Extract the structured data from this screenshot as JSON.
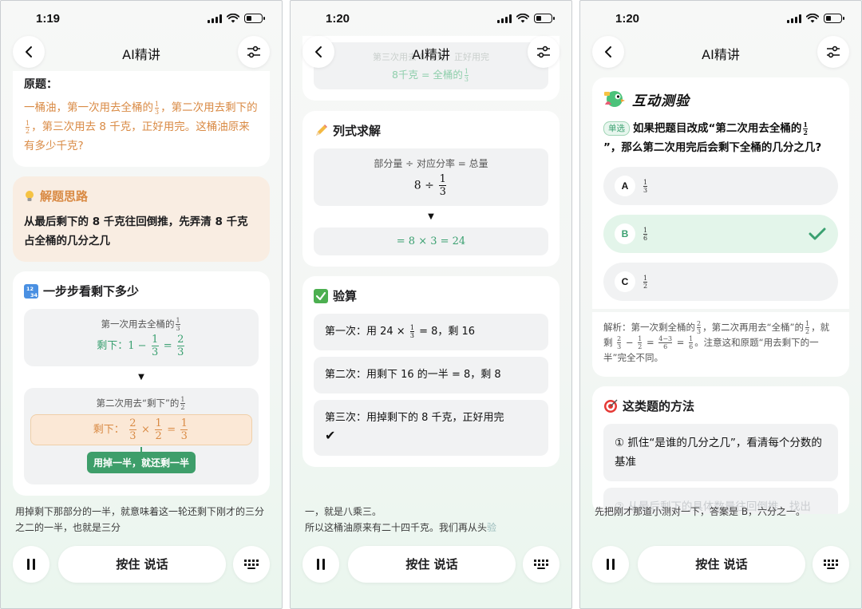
{
  "screens": [
    {
      "time": "1:19",
      "title": "AI精讲",
      "original": {
        "heading": "原题：",
        "p1": "一桶油，第一次用去全桶的",
        "p2": "，第二次用去剩下的",
        "p3": "，第三次用去 8 千克，正好用完。这桶油原来有多少千克?"
      },
      "thinking": {
        "heading": "解题思路",
        "body": "从最后剩下的 8 千克往回倒推，先弄清 8 千克占全桶的几分之几"
      },
      "steps": {
        "heading": "一步步看剩下多少",
        "step1_line": "第一次用去全桶的",
        "step1_label": "剩下：",
        "step1_expr": "1 −",
        "step2_line": "第二次用去“剩下”的",
        "step2_label": "剩下：",
        "bubble": "用掉一半，就还剩一半"
      },
      "subtitle": "用掉剩下那部分的一半，就意味着这一轮还剩下刚才的三分之二的一半，也就是三分",
      "talk_label": "按住 说话"
    },
    {
      "time": "1:20",
      "title": "AI精讲",
      "top_fade_1": "第三次用去 8 千克，正好用完",
      "top_fade_2": "8千克 = 全桶的",
      "equation": {
        "heading": "列式求解",
        "formula": "部分量 ÷ 对应分率 = 总量",
        "expr": "8 ÷",
        "result": "= 8 × 3 = 24"
      },
      "verify": {
        "heading": "验算",
        "row1_a": "第一次：用 24 ×",
        "row1_b": "= 8，剩 16",
        "row2": "第二次：用剩下 16 的一半 = 8，剩 8",
        "row3": "第三次：用掉剩下的 8 千克，正好用完",
        "row3_mark": "✔"
      },
      "subtitle1": "一，就是八乘三。",
      "subtitle2": "所以这桶油原来有二十四千克。我们再从头",
      "subtitle2_fade": "验",
      "talk_label": "按住 说话"
    },
    {
      "time": "1:20",
      "title": "AI精讲",
      "quiz": {
        "heading": "互动测验",
        "tag": "单选",
        "q1": "如果把题目改成“第二次用去全桶的",
        "q2": "”，那么第二次用完后会剩下全桶的几分之几?",
        "options": [
          {
            "letter": "A",
            "num": "1",
            "den": "3"
          },
          {
            "letter": "B",
            "num": "1",
            "den": "6"
          },
          {
            "letter": "C",
            "num": "1",
            "den": "2"
          }
        ],
        "selected": "B"
      },
      "explain": {
        "a": "解析：第一次剩全桶的",
        "b": "，第二次再用去“全桶”的",
        "c": "，就剩",
        "d": "。注意这和原题“用去剩下的一半”完全不同。"
      },
      "method": {
        "heading": "这类题的方法",
        "tip1": "① 抓住“是谁的几分之几”，看清每个分数的基准",
        "tip2": "② 从最后剩下的具体数量往回倒推，找出"
      },
      "subtitle": "先把刚才那道小测对一下，答案是 B，六分之一。",
      "talk_label": "按住 说话"
    }
  ]
}
